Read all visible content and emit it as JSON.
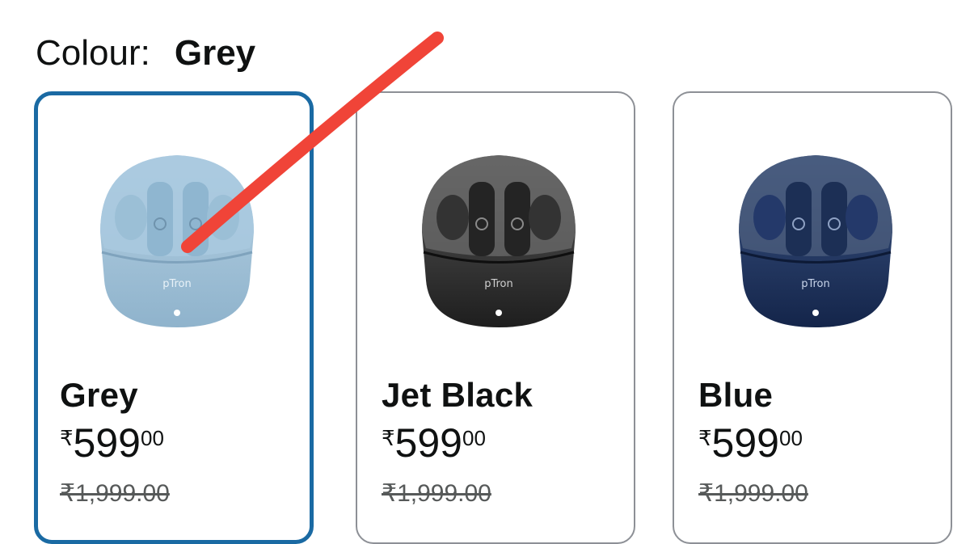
{
  "colour": {
    "label": "Colour:",
    "value": "Grey"
  },
  "variants": [
    {
      "name": "Grey",
      "currency": "₹",
      "price_whole": "599",
      "price_fraction": "00",
      "mrp": "₹1,999.00",
      "selected": true,
      "accent": "#9cc0d8"
    },
    {
      "name": "Jet Black",
      "currency": "₹",
      "price_whole": "599",
      "price_fraction": "00",
      "mrp": "₹1,999.00",
      "selected": false,
      "accent": "#2b2b2b"
    },
    {
      "name": "Blue",
      "currency": "₹",
      "price_whole": "599",
      "price_fraction": "00",
      "mrp": "₹1,999.00",
      "selected": false,
      "accent": "#1e3358"
    }
  ],
  "brand_mark": "pTron",
  "colors": {
    "selected_border": "#1a6aa3",
    "card_border": "#8d9096",
    "annotation": "#f04438"
  }
}
